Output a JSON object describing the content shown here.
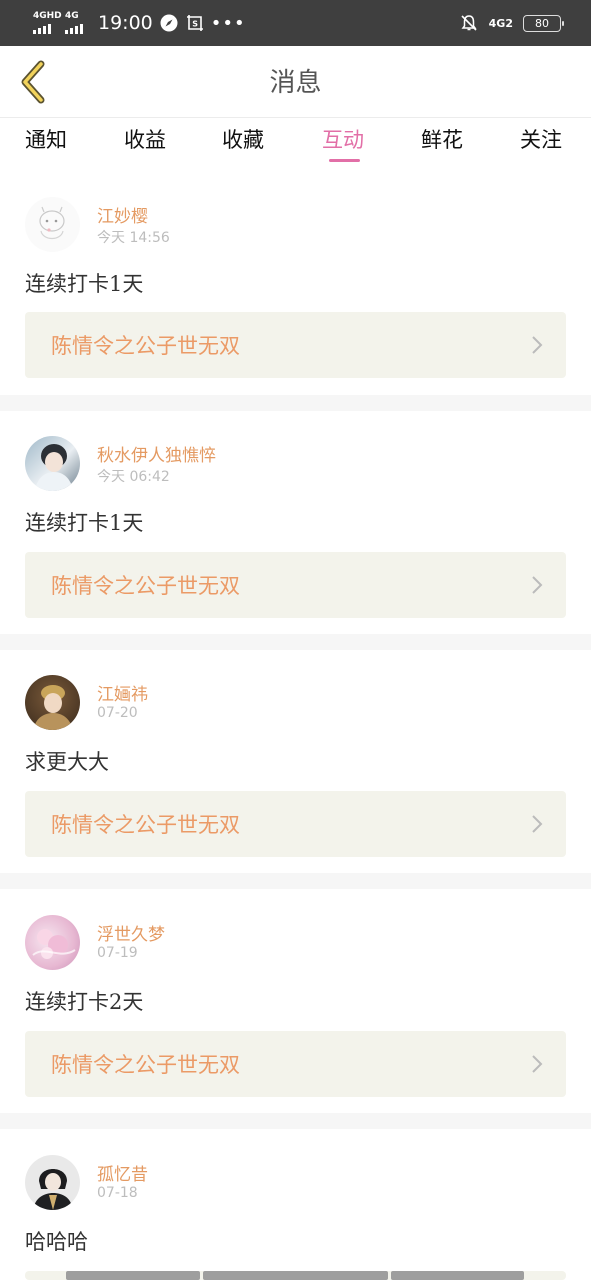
{
  "status_bar": {
    "signal1_label": "4GHD",
    "signal2_label": "4G",
    "time": "19:00",
    "more_dots": "•••",
    "network_label": "4G2",
    "battery_level": "80"
  },
  "header": {
    "title": "消息"
  },
  "tabs": [
    {
      "label": "通知",
      "active": false
    },
    {
      "label": "收益",
      "active": false
    },
    {
      "label": "收藏",
      "active": false
    },
    {
      "label": "互动",
      "active": true
    },
    {
      "label": "鲜花",
      "active": false
    },
    {
      "label": "关注",
      "active": false
    }
  ],
  "messages": [
    {
      "user": "江妙樱",
      "time": "今天 14:56",
      "text": "连续打卡1天",
      "link": "陈情令之公子世无双"
    },
    {
      "user": "秋水伊人独憔悴",
      "time": "今天 06:42",
      "text": "连续打卡1天",
      "link": "陈情令之公子世无双"
    },
    {
      "user": "江婳祎",
      "time": "07-20",
      "text": "求更大大",
      "link": "陈情令之公子世无双"
    },
    {
      "user": "浮世久梦",
      "time": "07-19",
      "text": "连续打卡2天",
      "link": "陈情令之公子世无双"
    },
    {
      "user": "孤忆昔",
      "time": "07-18",
      "text": "哈哈哈",
      "link": ""
    }
  ],
  "colors": {
    "accent_pink": "#e26fa7",
    "username_orange": "#e49a62",
    "link_orange": "#eb9a66",
    "card_bg": "#f3f3eb",
    "status_bar_bg": "#3f3f3f"
  }
}
